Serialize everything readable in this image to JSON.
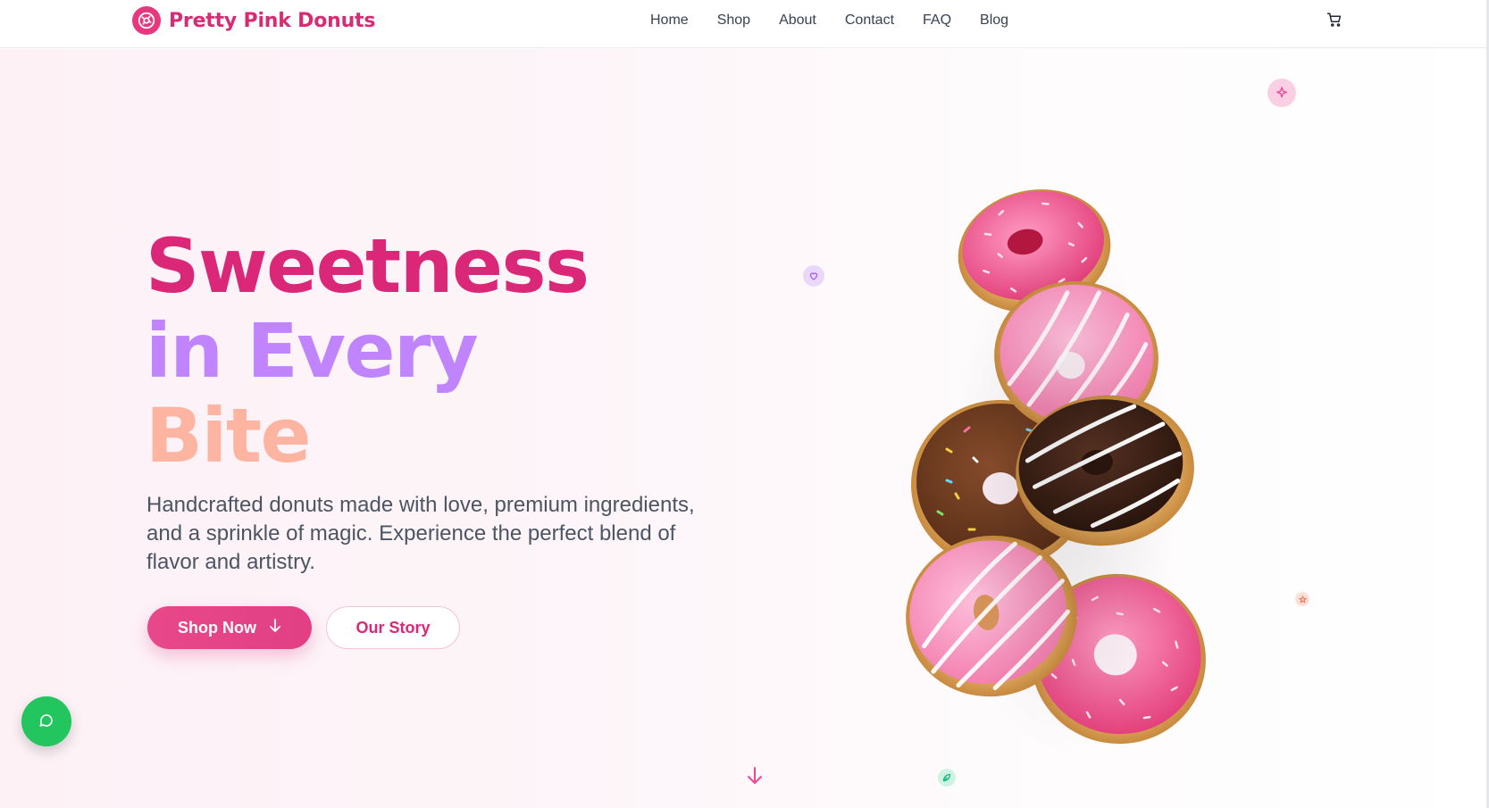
{
  "brand": {
    "name": "Pretty Pink Donuts",
    "icon": "donut-icon",
    "color": "#db2777"
  },
  "nav": {
    "links": [
      {
        "label": "Home"
      },
      {
        "label": "Shop"
      },
      {
        "label": "About"
      },
      {
        "label": "Contact"
      },
      {
        "label": "FAQ"
      },
      {
        "label": "Blog"
      }
    ],
    "cart_icon": "cart-icon"
  },
  "hero": {
    "headline": {
      "line1": "Sweetness",
      "line2": "in Every",
      "line3": "Bite"
    },
    "headline_colors": {
      "line1": "#db2777",
      "line2": "#c084fc",
      "line3": "#fdb4a0"
    },
    "subtitle": "Handcrafted donuts made with love, premium ingredients, and a sprinkle of magic. Experience the perfect blend of flavor and artistry.",
    "primary_button": {
      "label": "Shop Now",
      "icon": "arrow-down-icon"
    },
    "secondary_button": {
      "label": "Our Story"
    },
    "decorations": [
      "sparkle-icon",
      "heart-icon",
      "star-icon",
      "leaf-icon"
    ],
    "scroll_icon": "arrow-down-icon"
  },
  "chat": {
    "icon": "chat-bubble-icon",
    "color": "#22c55e"
  },
  "image": {
    "subject": "stack-of-donuts"
  }
}
